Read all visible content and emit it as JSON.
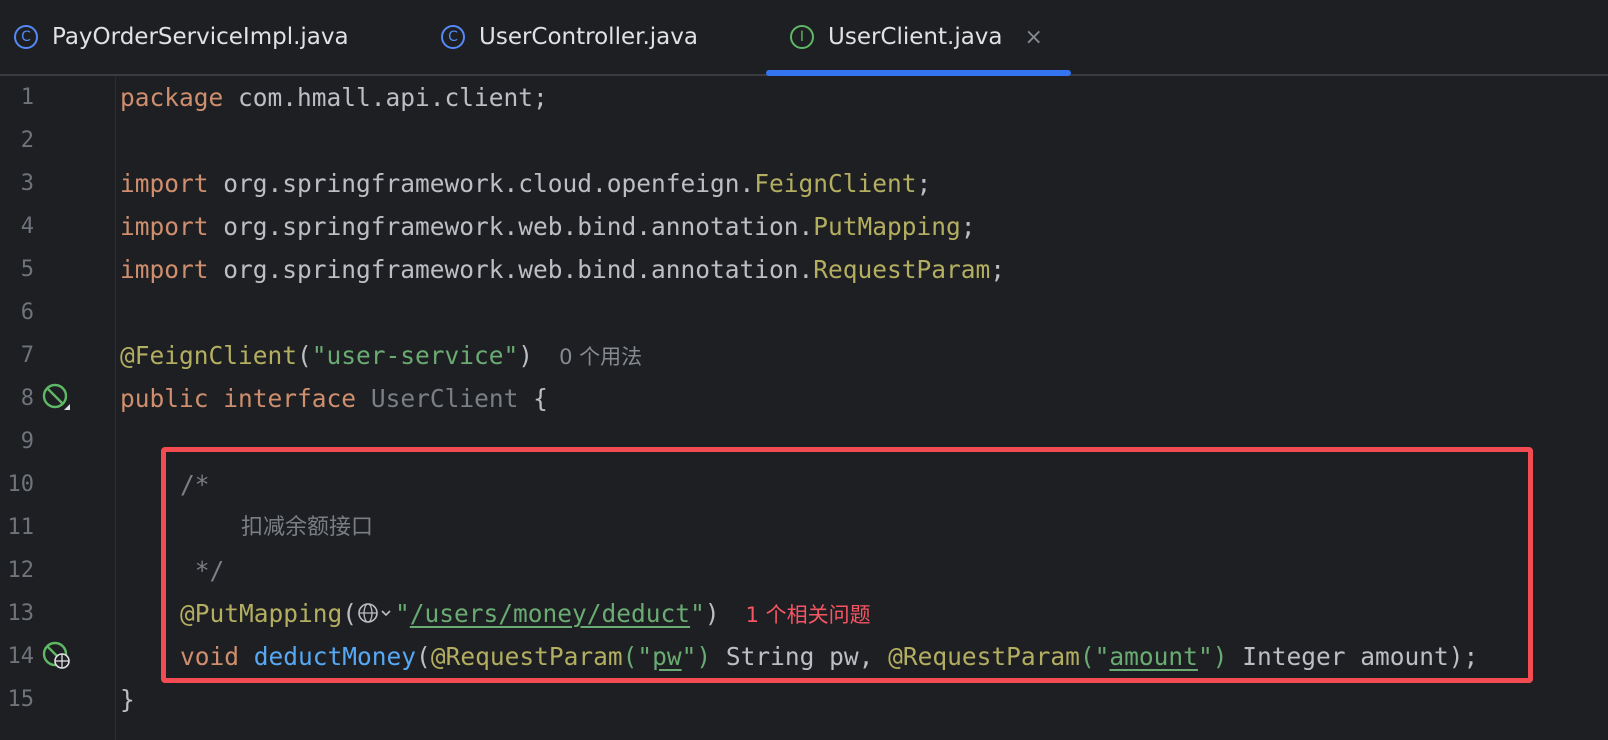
{
  "tabs": [
    {
      "label": "PayOrderServiceImpl.java",
      "icon": "class-icon",
      "active": false
    },
    {
      "label": "UserController.java",
      "icon": "class-icon",
      "active": false
    },
    {
      "label": "UserClient.java",
      "icon": "interface-icon",
      "active": true
    }
  ],
  "tab_icon_letters": {
    "class": "C",
    "interface": "I"
  },
  "close_glyph": "×",
  "line_numbers": [
    "1",
    "2",
    "3",
    "4",
    "5",
    "6",
    "7",
    "8",
    "9",
    "10",
    "11",
    "12",
    "13",
    "14",
    "15"
  ],
  "code": {
    "l1": {
      "kw": "package",
      "rest": " com.hmall.api.client;"
    },
    "l3": {
      "kw": "import",
      "path": " org.springframework.cloud.openfeign.",
      "cls": "FeignClient",
      "end": ";"
    },
    "l4": {
      "kw": "import",
      "path": " org.springframework.web.bind.annotation.",
      "cls": "PutMapping",
      "end": ";"
    },
    "l5": {
      "kw": "import",
      "path": " org.springframework.web.bind.annotation.",
      "cls": "RequestParam",
      "end": ";"
    },
    "l7": {
      "ann": "@FeignClient",
      "open": "(",
      "str": "\"user-service\"",
      "close": ")",
      "hint": "0 个用法"
    },
    "l8": {
      "kw1": "public",
      "kw2": "interface",
      "name": "UserClient",
      "brace": " {"
    },
    "l10": {
      "text": "/*"
    },
    "l11": {
      "text": "扣减余额接口"
    },
    "l12": {
      "text": " */"
    },
    "l13": {
      "ann": "@PutMapping",
      "open": "(",
      "q1": "\"",
      "path": "/users/money/deduct",
      "q2": "\"",
      "close": ")",
      "hint": "1 个相关问题"
    },
    "l14": {
      "kw": "void",
      "fn": "deductMoney",
      "open": "(",
      "ann1": "@RequestParam",
      "p1o": "(\"",
      "p1": "pw",
      "p1c": "\")",
      "t1": " String pw, ",
      "ann2": "@RequestParam",
      "p2o": "(\"",
      "p2": "amount",
      "p2c": "\")",
      "t2": " Integer amount);"
    },
    "l15": {
      "text": "}"
    }
  },
  "colors": {
    "keyword": "#cf8e6d",
    "annotation": "#b3ae60",
    "string": "#6aab73",
    "function": "#56a8f5",
    "comment": "#7a7e85",
    "error_hint": "#f75464",
    "highlight_box": "#f24b52",
    "active_tab_underline": "#3574f0"
  }
}
